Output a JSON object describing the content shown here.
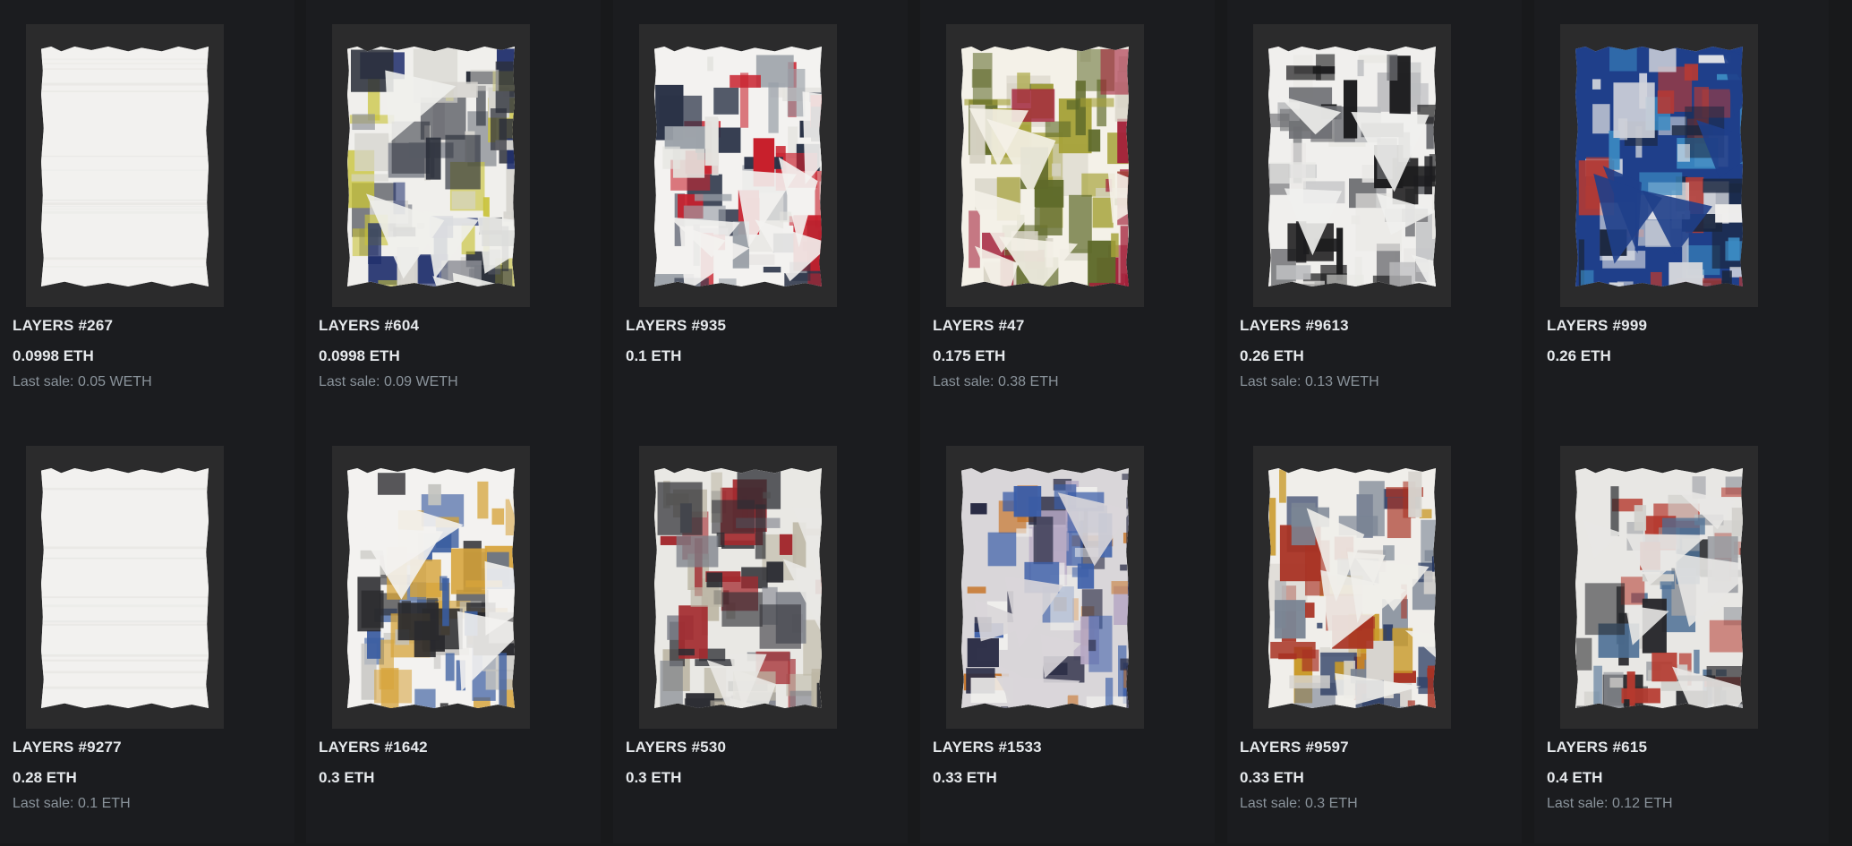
{
  "listings": [
    {
      "name": "LAYERS #267",
      "price": "0.0998 ETH",
      "last_sale_label": "Last sale:",
      "last_sale": "0.05 WETH",
      "art": "blank"
    },
    {
      "name": "LAYERS #604",
      "price": "0.0998 ETH",
      "last_sale_label": "Last sale:",
      "last_sale": "0.09 WETH",
      "art": "buildings"
    },
    {
      "name": "LAYERS #935",
      "price": "0.1 ETH",
      "last_sale_label": "",
      "last_sale": "",
      "art": "windows"
    },
    {
      "name": "LAYERS #47",
      "price": "0.175 ETH",
      "last_sale_label": "Last sale:",
      "last_sale": "0.38 ETH",
      "art": "figure"
    },
    {
      "name": "LAYERS #9613",
      "price": "0.26 ETH",
      "last_sale_label": "Last sale:",
      "last_sale": "0.13 WETH",
      "art": "city"
    },
    {
      "name": "LAYERS #999",
      "price": "0.26 ETH",
      "last_sale_label": "",
      "last_sale": "",
      "art": "collage-blue"
    },
    {
      "name": "LAYERS #9277",
      "price": "0.28 ETH",
      "last_sale_label": "Last sale:",
      "last_sale": "0.1 ETH",
      "art": "blank"
    },
    {
      "name": "LAYERS #1642",
      "price": "0.3 ETH",
      "last_sale_label": "",
      "last_sale": "",
      "art": "torn"
    },
    {
      "name": "LAYERS #530",
      "price": "0.3 ETH",
      "last_sale_label": "",
      "last_sale": "",
      "art": "street"
    },
    {
      "name": "LAYERS #1533",
      "price": "0.33 ETH",
      "last_sale_label": "",
      "last_sale": "",
      "art": "collage-mixed"
    },
    {
      "name": "LAYERS #9597",
      "price": "0.33 ETH",
      "last_sale_label": "Last sale:",
      "last_sale": "0.3 ETH",
      "art": "collage-warm"
    },
    {
      "name": "LAYERS #615",
      "price": "0.4 ETH",
      "last_sale_label": "Last sale:",
      "last_sale": "0.12 ETH",
      "art": "collage-gray"
    }
  ],
  "colors": {
    "background": "#18191b",
    "card": "#1b1c1f",
    "media_frame": "#2b2b2c",
    "text_primary": "#e5e8eb",
    "text_secondary": "#8a939b"
  }
}
